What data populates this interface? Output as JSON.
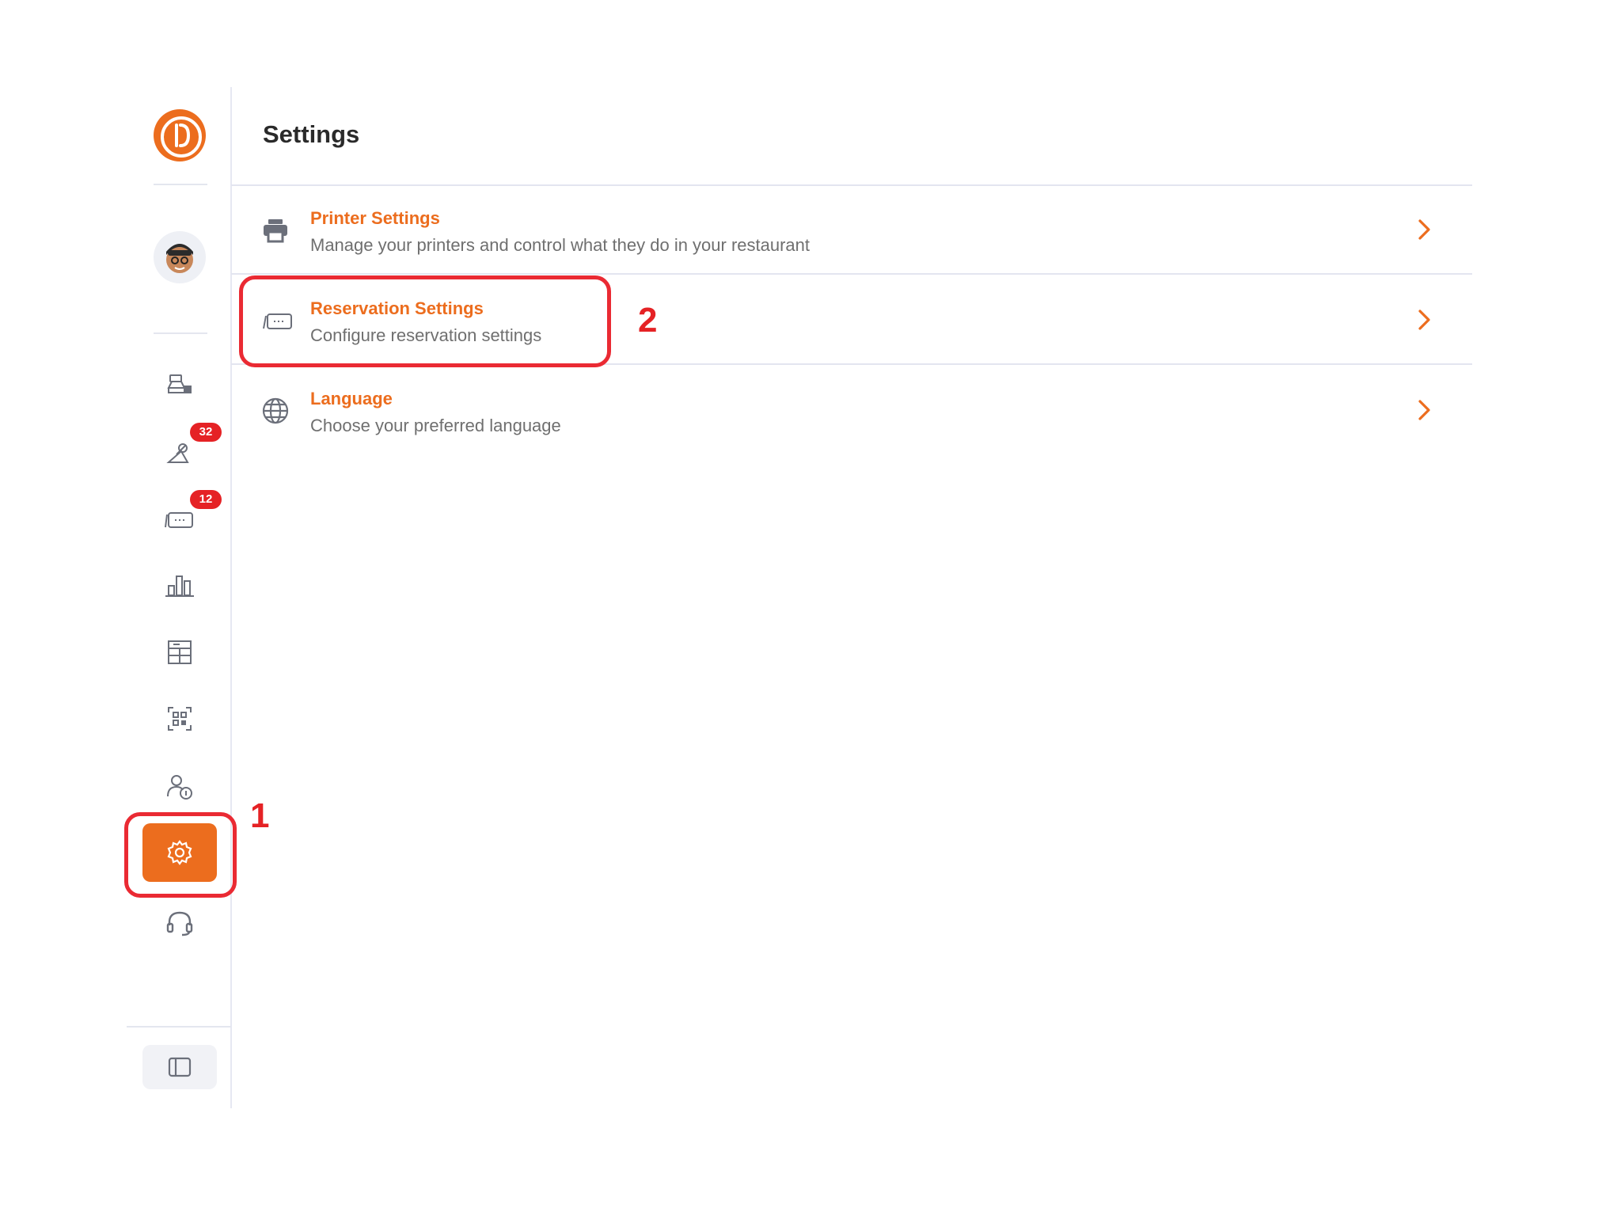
{
  "page": {
    "title": "Settings"
  },
  "sidebar": {
    "logo_icon": "restaurant-logo-icon",
    "avatar_icon": "user-avatar",
    "items": [
      {
        "name": "pos-icon"
      },
      {
        "name": "orders-icon",
        "badge": "32"
      },
      {
        "name": "reservations-icon",
        "badge": "12"
      },
      {
        "name": "reports-icon"
      },
      {
        "name": "menu-icon"
      },
      {
        "name": "qr-code-icon"
      },
      {
        "name": "staff-icon"
      },
      {
        "name": "gear-icon",
        "active": true
      },
      {
        "name": "headset-icon"
      }
    ],
    "collapse_icon": "sidebar-toggle-icon"
  },
  "settings_list": [
    {
      "icon": "printer-icon",
      "title": "Printer Settings",
      "description": "Manage your printers and control what they do in your restaurant"
    },
    {
      "icon": "reservation-icon",
      "title": "Reservation Settings",
      "description": "Configure reservation settings"
    },
    {
      "icon": "globe-icon",
      "title": "Language",
      "description": "Choose your preferred language"
    }
  ],
  "annotations": {
    "step1": "1",
    "step2": "2"
  },
  "colors": {
    "accent": "#ec6d1e",
    "badge": "#e52225",
    "highlight": "#ea2a33",
    "border": "#e3e5f0"
  }
}
